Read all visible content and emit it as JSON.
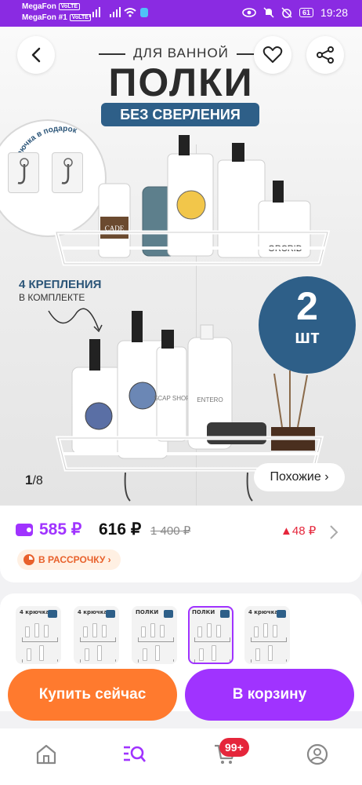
{
  "status_bar": {
    "carrier1": "MegaFon",
    "carrier1_tag": "VoLTE",
    "carrier2": "MegaFon #1",
    "carrier2_tag": "VoLTE",
    "battery": "61",
    "time": "19:28"
  },
  "hero": {
    "promo_subtitle": "ДЛЯ ВАННОЙ",
    "promo_title": "ПОЛКИ",
    "promo_badge": "БЕЗ СВЕРЛЕНИЯ",
    "hooks_text": "4 крючка в подарок",
    "mounts_title": "4 КРЕПЛЕНИЯ",
    "mounts_subtitle": "В КОМПЛЕКТЕ",
    "count_number": "2",
    "count_unit": "шт",
    "product_label_1": "CADE",
    "product_label_2": "ORCRID",
    "product_label_3": "SCAP SHOPE",
    "product_label_4": "ENTERO",
    "image_index": "1",
    "image_total": "8",
    "similar_button": "Похожие ›"
  },
  "price": {
    "card_price": "585 ₽",
    "regular_price": "616 ₽",
    "old_price": "1 400 ₽",
    "price_drop": "▲48 ₽",
    "installment": "В РАССРОЧКУ ›"
  },
  "thumbnails": {
    "items": [
      {
        "title": "4 крючка",
        "active": false
      },
      {
        "title": "4 крючка",
        "active": false
      },
      {
        "title": "ПОЛКИ",
        "active": false
      },
      {
        "title": "ПОЛКИ",
        "active": true
      },
      {
        "title": "4 крючка",
        "active": false
      }
    ]
  },
  "actions": {
    "buy_now": "Купить сейчас",
    "add_to_cart": "В корзину"
  },
  "bottom_nav": {
    "cart_badge": "99+"
  },
  "colors": {
    "accent": "#a033ff",
    "buy": "#ff7a2e",
    "promo_blue": "#2e5f88",
    "price_drop": "#e5263b",
    "status_bar": "#8a2be2"
  }
}
